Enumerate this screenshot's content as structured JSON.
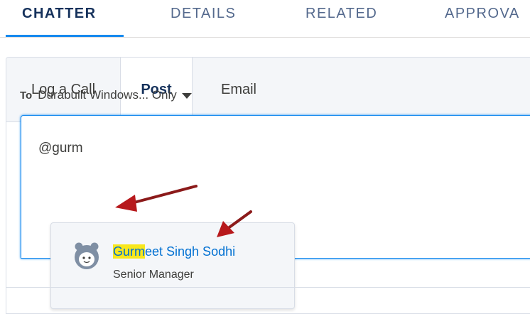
{
  "top_tabs": [
    {
      "label": "CHATTER"
    },
    {
      "label": "DETAILS"
    },
    {
      "label": "RELATED"
    },
    {
      "label": "APPROVA"
    }
  ],
  "publisher": {
    "tabs": [
      {
        "label": "Log a Call"
      },
      {
        "label": "Post"
      },
      {
        "label": "Email"
      }
    ],
    "to_label": "To",
    "audience": "Durabuilt Windows... Only",
    "compose_text": "@gurm"
  },
  "mention": {
    "name_match": "Gurm",
    "name_rest": "eet Singh Sodhi",
    "title": "Senior Manager",
    "avatar_icon": "user-avatar-icon"
  },
  "colors": {
    "accent": "#1589ee",
    "link": "#0070d2",
    "highlight": "#f8e71c",
    "annotation_arrow": "#b7191c"
  }
}
